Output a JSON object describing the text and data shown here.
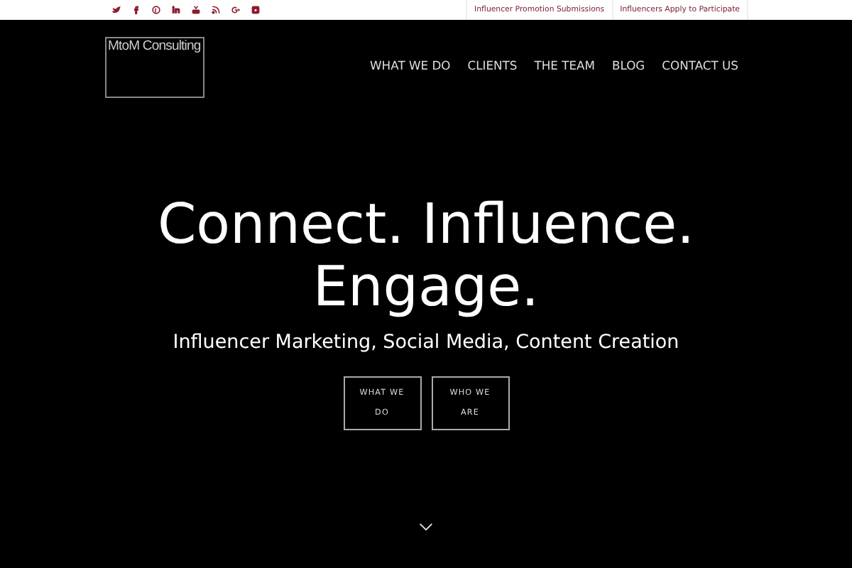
{
  "top_links": [
    "Influencer Promotion Submissions",
    "Influencers Apply to Participate"
  ],
  "logo": "MtoM Consulting",
  "nav": [
    "WHAT WE DO",
    "CLIENTS",
    "THE TEAM",
    "BLOG",
    "CONTACT US"
  ],
  "hero": {
    "headline_lines": [
      "Connect. Influence.",
      "Engage."
    ],
    "subtitle": "Influencer Marketing, Social Media, Content Creation",
    "buttons": [
      "WHAT WE DO",
      "WHO WE ARE"
    ]
  }
}
